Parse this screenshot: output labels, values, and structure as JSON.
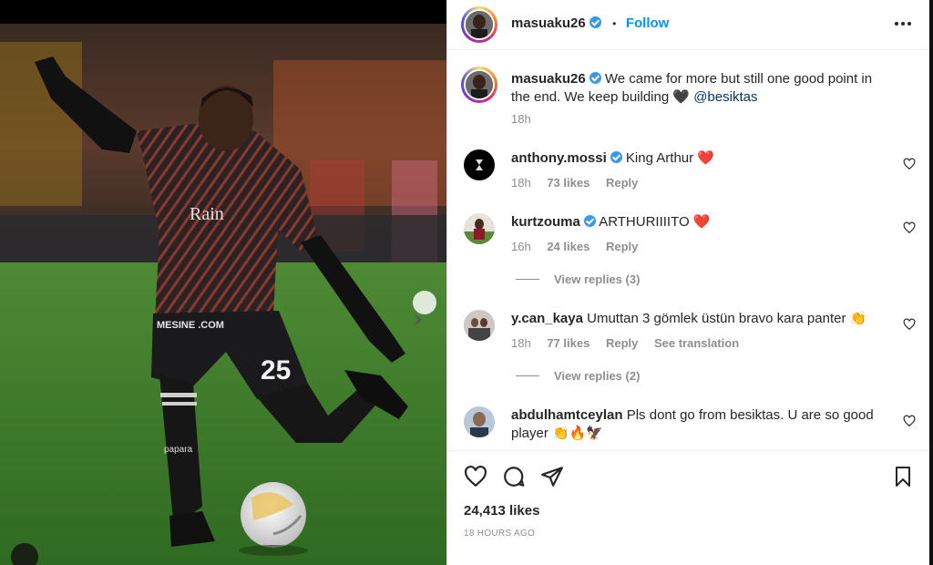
{
  "header": {
    "username": "masuaku26",
    "separator": "•",
    "follow_label": "Follow",
    "more_icon": "more-horizontal-icon"
  },
  "caption": {
    "username": "masuaku26",
    "text": "We came for more but still one good point in the end. We keep building 🖤",
    "mention": "@besiktas",
    "time": "18h"
  },
  "comments": [
    {
      "username": "anthony.mossi",
      "verified": true,
      "text": "King Arthur ❤️",
      "time": "18h",
      "likes": "73 likes",
      "reply_label": "Reply"
    },
    {
      "username": "kurtzouma",
      "verified": true,
      "text": "ARTHURIIIITO ❤️",
      "time": "16h",
      "likes": "24 likes",
      "reply_label": "Reply",
      "view_replies": "View replies (3)"
    },
    {
      "username": "y.can_kaya",
      "verified": false,
      "text": "Umuttan 3 gömlek üstün bravo kara panter 👏",
      "time": "18h",
      "likes": "77 likes",
      "reply_label": "Reply",
      "translate_label": "See translation",
      "view_replies": "View replies (2)"
    },
    {
      "username": "abdulhamtceylan",
      "verified": false,
      "text": "Pls dont go from besiktas. U are so good player 👏🔥🦅"
    }
  ],
  "footer": {
    "likes": "24,413 likes",
    "timestamp": "18 HOURS AGO"
  },
  "photo": {
    "jersey_number": "25",
    "sponsor": "Rain",
    "shorts_sponsor": "MESINE .COM",
    "sock_brand": "adidas",
    "shin_brand": "papara"
  },
  "colors": {
    "accent": "#0095f6",
    "verified": "#3897f0",
    "pitch": "#3f7a2c",
    "muted": "#8e8e8e"
  }
}
